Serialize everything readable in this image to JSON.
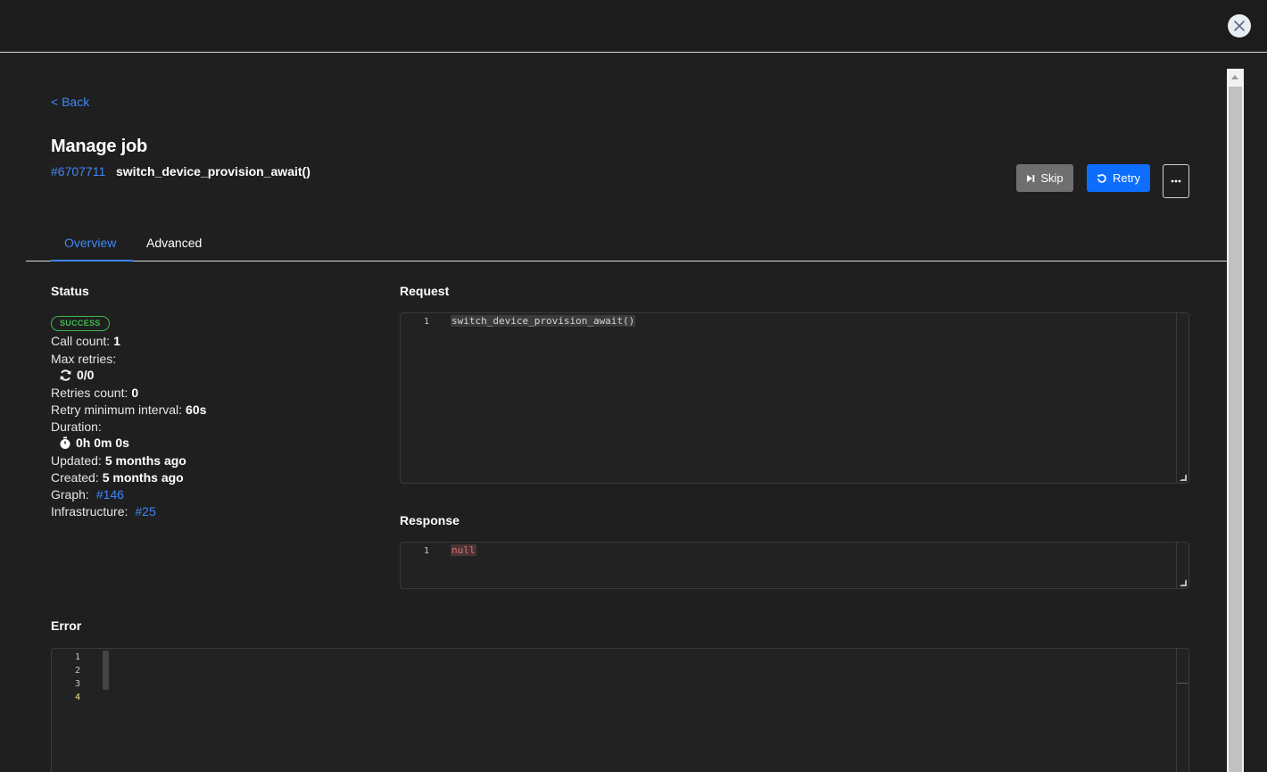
{
  "nav": {
    "back_label": "< Back"
  },
  "header": {
    "title": "Manage job",
    "job_id": "#6707711",
    "job_function": "switch_device_provision_await()"
  },
  "actions": {
    "skip_label": "Skip",
    "retry_label": "Retry",
    "more_label": "•••"
  },
  "tabs": [
    {
      "label": "Overview",
      "active": true
    },
    {
      "label": "Advanced",
      "active": false
    }
  ],
  "status": {
    "title": "Status",
    "badge": "SUCCESS",
    "call_count_label": "Call count:",
    "call_count": "1",
    "max_retries_label": "Max retries:",
    "max_retries": "0/0",
    "retries_count_label": "Retries count:",
    "retries_count": "0",
    "retry_interval_label": "Retry minimum interval:",
    "retry_interval": "60s",
    "duration_label": "Duration:",
    "duration": "0h 0m 0s",
    "updated_label": "Updated:",
    "updated": "5 months ago",
    "created_label": "Created:",
    "created": "5 months ago",
    "graph_label": "Graph:",
    "graph": "#146",
    "infrastructure_label": "Infrastructure:",
    "infrastructure": "#25"
  },
  "request": {
    "title": "Request",
    "lines": [
      {
        "no": "1",
        "code": "switch_device_provision_await()"
      }
    ]
  },
  "response": {
    "title": "Response",
    "lines": [
      {
        "no": "1",
        "code": "null"
      }
    ]
  },
  "error": {
    "title": "Error",
    "line_numbers": [
      "1",
      "2",
      "3",
      "4"
    ]
  },
  "colors": {
    "accent": "#0d6efd",
    "link": "#3f86f7",
    "success": "#3fb950",
    "background": "#1f1f1f"
  }
}
